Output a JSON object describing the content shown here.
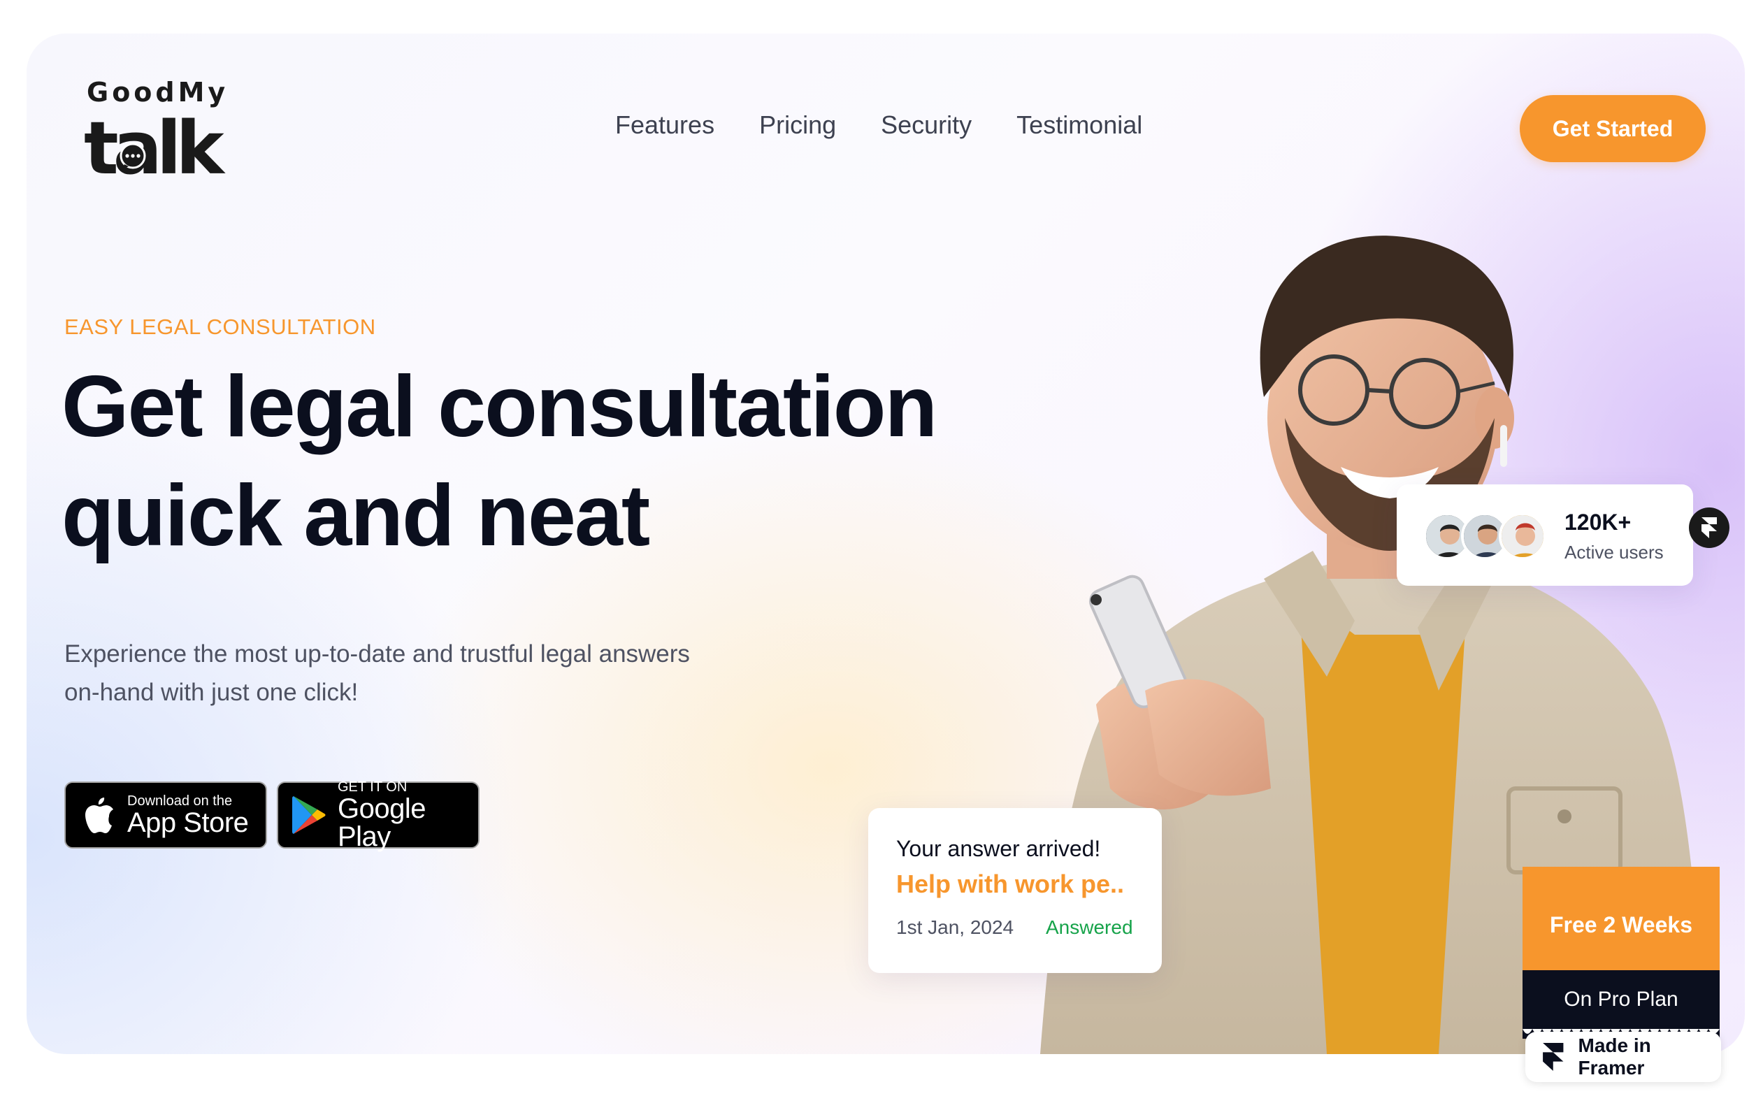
{
  "logo": {
    "top": "GoodMy",
    "main": "talk"
  },
  "nav": {
    "items": [
      "Features",
      "Pricing",
      "Security",
      "Testimonial"
    ]
  },
  "cta": {
    "label": "Get Started"
  },
  "hero": {
    "eyebrow": "EASY LEGAL CONSULTATION",
    "headline_line1": "Get legal consultation",
    "headline_line2": "quick and neat",
    "subtext_line1": "Experience the most up-to-date and trustful legal answers",
    "subtext_line2": "on-hand with just one click!"
  },
  "stores": {
    "appstore_small": "Download on the",
    "appstore_big": "App Store",
    "googleplay_small": "GET IT ON",
    "googleplay_big": "Google Play"
  },
  "users_card": {
    "count": "120K+",
    "label": "Active users"
  },
  "answer_card": {
    "title": "Your answer arrived!",
    "subject": "Help with work pe..",
    "date": "1st Jan, 2024",
    "status": "Answered"
  },
  "promo": {
    "top": "Free 2 Weeks",
    "bottom": "On Pro Plan"
  },
  "badge": {
    "label": "Made in Framer"
  },
  "colors": {
    "accent": "#f7962d",
    "ink": "#0b0f1e",
    "success": "#16a34a"
  }
}
